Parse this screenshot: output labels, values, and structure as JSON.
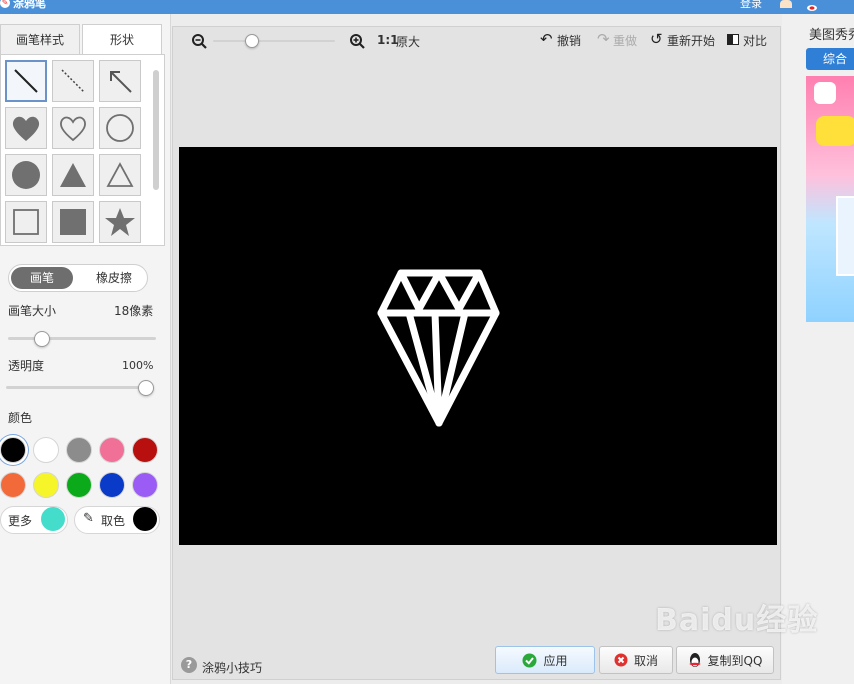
{
  "titlebar": {
    "title": "涂鸦笔",
    "login": "登录"
  },
  "left": {
    "tabs": [
      {
        "label": "画笔样式"
      },
      {
        "label": "形状"
      }
    ],
    "mode": {
      "brush": "画笔",
      "eraser": "橡皮擦"
    },
    "brush_size": {
      "label": "画笔大小",
      "value": "18像素",
      "fraction": 0.2
    },
    "opacity": {
      "label": "透明度",
      "value": "100%",
      "fraction": 1.0
    },
    "color_label": "颜色",
    "colors": [
      "#000000",
      "#ffffff",
      "#8c8c8c",
      "#f07098",
      "#b80f0f",
      "#f26a3a",
      "#f5f52a",
      "#0aaa1a",
      "#0a3ac8",
      "#9a5cf5"
    ],
    "more": {
      "label": "更多",
      "color": "#44ddcc"
    },
    "picker": {
      "label": "取色",
      "color": "#000000"
    }
  },
  "toolbar": {
    "zoom_ratio": "1:1",
    "original": "原大",
    "zoom_fraction": 0.3,
    "undo": "撤销",
    "redo": "重做",
    "restart": "重新开始",
    "compare": "对比"
  },
  "bottom": {
    "tips": "涂鸦小技巧",
    "apply": "应用",
    "cancel": "取消",
    "copy_qq": "复制到QQ"
  },
  "right": {
    "title": "美图秀秀",
    "tab": "综合"
  },
  "watermark": "Baidu经验"
}
